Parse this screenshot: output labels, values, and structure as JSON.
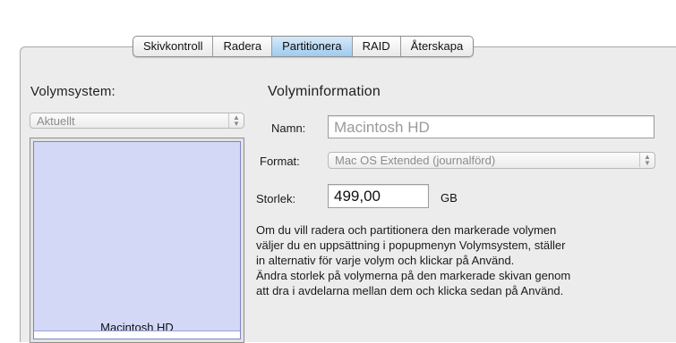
{
  "tabs": [
    {
      "label": "Skivkontroll",
      "active": false
    },
    {
      "label": "Radera",
      "active": false
    },
    {
      "label": "Partitionera",
      "active": true
    },
    {
      "label": "RAID",
      "active": false
    },
    {
      "label": "Återskapa",
      "active": false
    }
  ],
  "volume_scheme": {
    "heading": "Volymsystem:",
    "popup_value": "Aktuellt",
    "volumes": [
      {
        "name": "Macintosh HD"
      }
    ]
  },
  "volume_info": {
    "heading": "Volyminformation",
    "name_label": "Namn:",
    "name_value": "Macintosh HD",
    "format_label": "Format:",
    "format_value": "Mac OS Extended (journalförd)",
    "size_label": "Storlek:",
    "size_value": "499,00",
    "size_unit": "GB"
  },
  "description": [
    "Om du vill radera och partitionera den markerade volymen",
    "väljer du en uppsättning i popupmenyn Volymsystem, ställer",
    "in alternativ för varje volym och klickar på Använd.",
    "Ändra storlek på volymerna på den markerade skivan genom",
    "att dra i avdelarna mellan dem och klicka sedan på Använd."
  ],
  "colors": {
    "accent_tab": "#9fcbee",
    "volume_fill": "#d3d8f6",
    "panel_bg": "#ececec"
  }
}
